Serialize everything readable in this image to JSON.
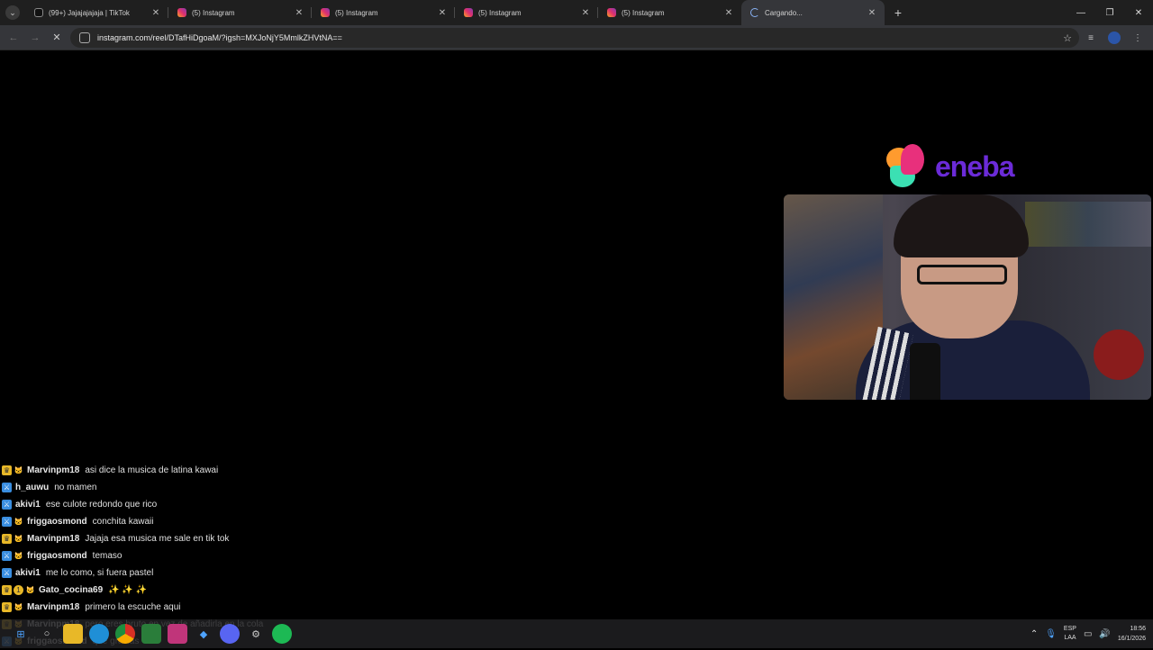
{
  "browser": {
    "tabs": [
      {
        "title": "(99+) Jajajajajaja | TikTok",
        "favicon": "tiktok-icon",
        "active": false
      },
      {
        "title": "(5) Instagram",
        "favicon": "instagram-icon",
        "active": false
      },
      {
        "title": "(5) Instagram",
        "favicon": "instagram-icon",
        "active": false
      },
      {
        "title": "(5) Instagram",
        "favicon": "instagram-icon",
        "active": false
      },
      {
        "title": "(5) Instagram",
        "favicon": "instagram-icon",
        "active": false
      },
      {
        "title": "Cargando...",
        "favicon": "loading-spinner-icon",
        "active": true
      }
    ],
    "close_glyph": "✕",
    "new_tab_glyph": "+",
    "url": "instagram.com/reel/DTafHiDgoaM/?igsh=MXJoNjY5MmlkZHVtNA=="
  },
  "overlay": {
    "brand_name": "eneba",
    "brand_colors": {
      "orange": "#ff9b2e",
      "pink": "#e8307c",
      "teal": "#3be0b3",
      "purple": "#6b2bd8"
    }
  },
  "chat": {
    "messages": [
      {
        "badges": [
          "crown",
          "cat"
        ],
        "user": "Marvinpm18",
        "text": "asi dice la musica de latina kawai"
      },
      {
        "badges": [
          "sword"
        ],
        "user": "h_auwu",
        "text": "no mamen"
      },
      {
        "badges": [
          "sword"
        ],
        "user": "akivi1",
        "text": "ese culote redondo que rico"
      },
      {
        "badges": [
          "sword",
          "cat"
        ],
        "user": "friggaosmond",
        "text": "conchita kawaii"
      },
      {
        "badges": [
          "crown",
          "cat"
        ],
        "user": "Marvinpm18",
        "text": "Jajaja esa musica me sale en tik tok"
      },
      {
        "badges": [
          "sword",
          "cat"
        ],
        "user": "friggaosmond",
        "text": "temaso"
      },
      {
        "badges": [
          "sword"
        ],
        "user": "akivi1",
        "text": "me lo como, si fuera pastel"
      },
      {
        "badges": [
          "crown",
          "one",
          "cat"
        ],
        "user": "Gato_cocina69",
        "text": "✨ ✨ ✨"
      },
      {
        "badges": [
          "crown",
          "cat"
        ],
        "user": "Marvinpm18",
        "text": "primero la escuche aqui"
      },
      {
        "badges": [
          "crown",
          "cat"
        ],
        "user": "Marvinpm18",
        "text": "pero eres bruto en vez de añadirla en la cola"
      },
      {
        "badges": [
          "sword",
          "cat"
        ],
        "user": "friggaosmond",
        "text": "que gracias"
      }
    ]
  },
  "taskbar": {
    "tray": {
      "lang_top": "ESP",
      "lang_bottom": "LAA",
      "time": "18:56",
      "date": "16/1/2026"
    }
  }
}
